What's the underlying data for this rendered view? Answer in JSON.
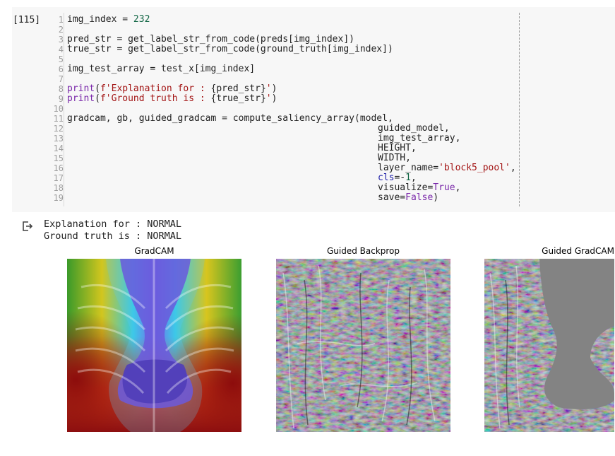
{
  "cell": {
    "exec_count": "[115]",
    "line_numbers": [
      "1",
      "2",
      "3",
      "4",
      "5",
      "6",
      "7",
      "8",
      "9",
      "10",
      "11",
      "12",
      "13",
      "14",
      "15",
      "16",
      "17",
      "18",
      "19"
    ],
    "code": {
      "l1": {
        "a": "img_index = ",
        "b": "232"
      },
      "l3": "pred_str = get_label_str_from_code(preds[img_index])",
      "l4": "true_str = get_label_str_from_code(ground_truth[img_index])",
      "l6": "img_test_array = test_x[img_index]",
      "l8": {
        "fn": "print",
        "p1": "(",
        "s1": "f'Explanation for : ",
        "mid": "{pred_str}",
        "s2": "'",
        "p2": ")"
      },
      "l9": {
        "fn": "print",
        "p1": "(",
        "s1": "f'Ground truth is : ",
        "mid": "{true_str}",
        "s2": "'",
        "p2": ")"
      },
      "l11": "gradcam, gb, guided_gradcam = compute_saliency_array(model,",
      "l12": "guided_model,",
      "l13": "img_test_array,",
      "l14": "HEIGHT,",
      "l15": "WIDTH,",
      "l16": {
        "a": "layer_name=",
        "s": "'block5_pool'",
        "b": ","
      },
      "l17": {
        "a": "cls",
        "b": "=-",
        "n": "1",
        "c": ","
      },
      "l18": {
        "a": "visualize=",
        "v": "True",
        "b": ","
      },
      "l19": {
        "a": "save=",
        "v": "False",
        "b": ")"
      }
    }
  },
  "output": {
    "lines": [
      "Explanation for : NORMAL",
      "Ground truth is : NORMAL"
    ],
    "icon": "output-redirect-icon"
  },
  "figure": {
    "titles": [
      "GradCAM",
      "Guided Backprop",
      "Guided GradCAM"
    ]
  },
  "colors": {
    "cell_bg": "#f7f7f7",
    "number": "#116644",
    "keyword": "#7927a9",
    "string": "#a31515"
  }
}
